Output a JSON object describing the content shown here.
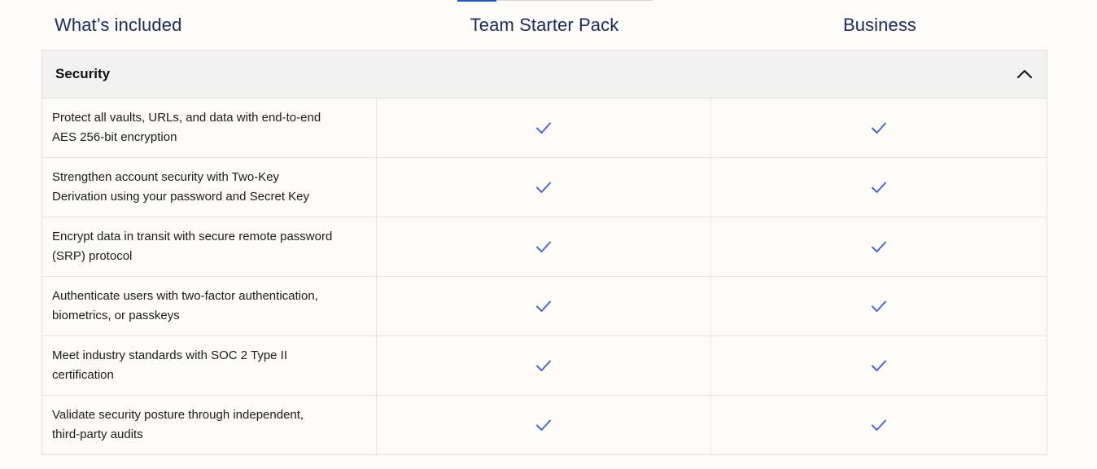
{
  "header": {
    "feature_column": "What’s included",
    "plans": [
      "Team Starter Pack",
      "Business"
    ]
  },
  "section": {
    "title": "Security",
    "toggle_icon": "chevron-up-icon",
    "expanded": true
  },
  "rows": [
    {
      "feature_line1": "Protect all vaults, URLs, and data with end-to-end",
      "feature_line2": "AES 256-bit encryption",
      "team_starter_pack": "check",
      "business": "check"
    },
    {
      "feature_line1": "Strengthen account security with Two-Key",
      "feature_line2": "Derivation using your password and Secret Key",
      "team_starter_pack": "check",
      "business": "check"
    },
    {
      "feature_line1": "Encrypt data in transit with secure remote password",
      "feature_line2": "(SRP) protocol",
      "team_starter_pack": "check",
      "business": "check"
    },
    {
      "feature_line1": "Authenticate users with two-factor authentication,",
      "feature_line2": "biometrics, or passkeys",
      "team_starter_pack": "check",
      "business": "check"
    },
    {
      "feature_line1": "Meet industry standards with SOC 2 Type II",
      "feature_line2": "certification",
      "team_starter_pack": "check",
      "business": "check"
    },
    {
      "feature_line1": "Validate security posture through independent,",
      "feature_line2": "third-party audits",
      "team_starter_pack": "check",
      "business": "check"
    }
  ],
  "colors": {
    "header_text": "#1b2a5b",
    "check": "#4a67c9",
    "section_bg": "#f2f2f2",
    "tab_indicator": "#1f5ab8"
  }
}
